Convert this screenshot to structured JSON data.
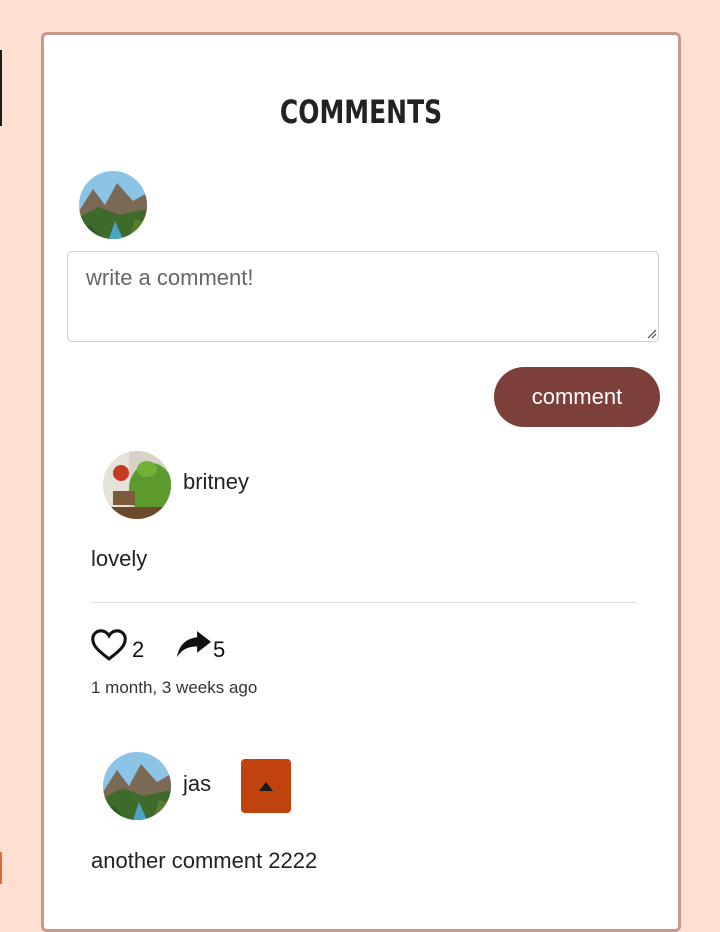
{
  "section_title": "COMMENTS",
  "new_comment": {
    "placeholder": "write a comment!",
    "submit_label": "comment"
  },
  "comments": [
    {
      "username": "britney",
      "text": "lovely",
      "likes": "2",
      "shares": "5",
      "timestamp": "1 month, 3 weeks ago"
    },
    {
      "username": "jas",
      "text": "another comment 2222"
    }
  ],
  "colors": {
    "page_background": "#fde0d2",
    "card_border": "#c8998a",
    "comment_button": "#7d3f3a",
    "reply_toggle": "#c0420c"
  },
  "icons": [
    "heart-outline-icon",
    "share-arrow-icon",
    "caret-up-icon"
  ]
}
